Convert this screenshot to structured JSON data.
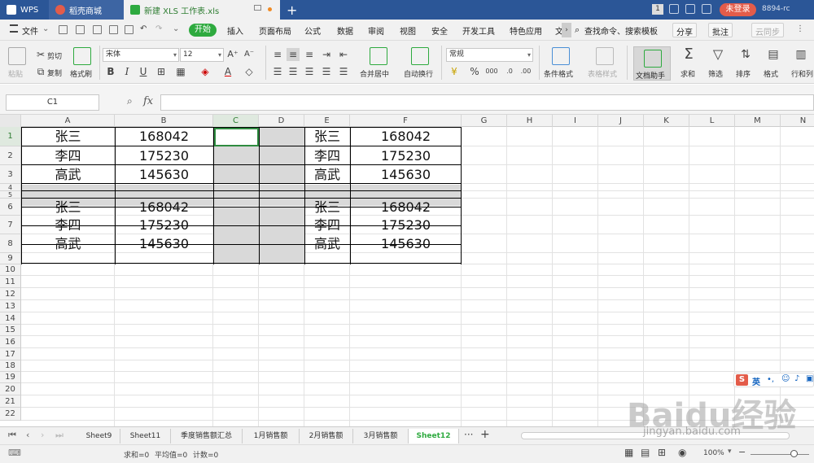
{
  "titlebar": {
    "tab_wps": "WPS",
    "tab_shop": "稻壳商城",
    "tab_doc": "新建 XLS 工作表.xls",
    "new_tab": "+",
    "window_count": "1",
    "login": "未登录",
    "user": "8894-rc"
  },
  "menubar": {
    "file": "文件",
    "start": "开始",
    "items": [
      "插入",
      "页面布局",
      "公式",
      "数据",
      "审阅",
      "视图",
      "安全",
      "开发工具",
      "特色应用",
      "文"
    ],
    "search": "查找命令、搜索模板",
    "share": "分享",
    "annotate": "批注",
    "cloud": "云同步"
  },
  "ribbon": {
    "paste": "粘贴",
    "cut": "剪切",
    "copy": "复制",
    "format_painter": "格式刷",
    "font_name": "宋体",
    "font_size": "12",
    "bold": "B",
    "italic": "I",
    "underline": "U",
    "merge": "合并居中",
    "wrap": "自动换行",
    "number_format": "常规",
    "percent": "%",
    "conditional_format": "条件格式",
    "table_style": "表格样式",
    "doc_helper": "文档助手",
    "sum": "求和",
    "filter": "筛选",
    "sort": "排序",
    "format": "格式",
    "rows_cols": "行和列"
  },
  "formula_bar": {
    "name_box": "C1",
    "fx": "fx"
  },
  "columns": [
    "A",
    "B",
    "C",
    "D",
    "E",
    "F",
    "G",
    "H",
    "I",
    "J",
    "K",
    "L",
    "M",
    "N"
  ],
  "rows": [
    "1",
    "2",
    "3",
    "4",
    "5",
    "6",
    "7",
    "8",
    "9",
    "10",
    "11",
    "12",
    "13",
    "14",
    "15",
    "16",
    "17",
    "18",
    "19",
    "20",
    "21",
    "22"
  ],
  "cells": {
    "A1": "张三",
    "B1": "168042",
    "E1": "张三",
    "F1": "168042",
    "A2": "李四",
    "B2": "175230",
    "E2": "李四",
    "F2": "175230",
    "A3": "高武",
    "B3": "145630",
    "E3": "高武",
    "F3": "145630",
    "A6": "张三",
    "B6": "168042",
    "E6": "张三",
    "F6": "168042",
    "A7": "李四",
    "B7": "175230",
    "E7": "李四",
    "F7": "175230",
    "A8": "高武",
    "B8": "145630",
    "E8": "高武",
    "F8": "145630"
  },
  "sheets": [
    "Sheet9",
    "Sheet11",
    "季度销售额汇总",
    "1月销售额",
    "2月销售额",
    "3月销售额",
    "Sheet12"
  ],
  "active_sheet": "Sheet12",
  "status": {
    "sum": "求和=0",
    "avg": "平均值=0",
    "count": "计数=0",
    "zoom": "100%"
  },
  "ime": "英",
  "watermark": "Baidu经验",
  "watermark_url": "jingyan.baidu.com",
  "colors": {
    "title_bg": "#2b5697",
    "accent_green": "#2eaa3f",
    "login_red": "#e35c4a",
    "gray_fill": "#d9d9d9"
  }
}
